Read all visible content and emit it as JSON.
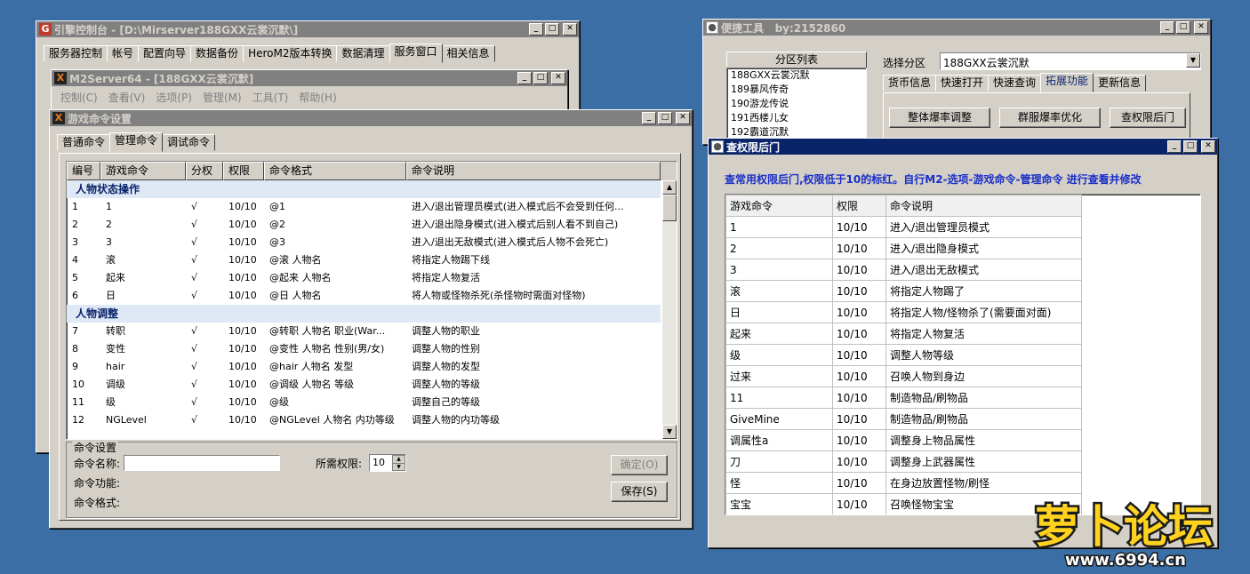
{
  "console": {
    "title": "引擎控制台 - [D:\\Mirserver188GXX云裳沉默\\]",
    "tabs": [
      "服务器控制",
      "帐号",
      "配置向导",
      "数据备份",
      "HeroM2版本转换",
      "数据清理",
      "服务窗口",
      "相关信息"
    ],
    "selected_tab": "服务窗口"
  },
  "m2server": {
    "title": "M2Server64 - [188GXX云裳沉默]",
    "menu": [
      "控制(C)",
      "查看(V)",
      "选项(P)",
      "管理(M)",
      "工具(T)",
      "帮助(H)"
    ]
  },
  "gamecmd": {
    "title": "游戏命令设置",
    "tabs": [
      "普通命令",
      "管理命令",
      "调试命令"
    ],
    "selected_tab": "管理命令",
    "columns": [
      "编号",
      "游戏命令",
      "分权",
      "权限",
      "命令格式",
      "命令说明"
    ],
    "groups": [
      {
        "name": "人物状态操作",
        "rows": [
          {
            "id": "1",
            "cmd": "1",
            "check": "√",
            "perm": "10/10",
            "fmt": "@1",
            "desc": "进入/退出管理员模式(进入模式后不会受到任何..."
          },
          {
            "id": "2",
            "cmd": "2",
            "check": "√",
            "perm": "10/10",
            "fmt": "@2",
            "desc": "进入/退出隐身模式(进入模式后别人看不到自己)"
          },
          {
            "id": "3",
            "cmd": "3",
            "check": "√",
            "perm": "10/10",
            "fmt": "@3",
            "desc": "进入/退出无敌模式(进入模式后人物不会死亡)"
          },
          {
            "id": "4",
            "cmd": "滚",
            "check": "√",
            "perm": "10/10",
            "fmt": "@滚 人物名",
            "desc": "将指定人物踢下线"
          },
          {
            "id": "5",
            "cmd": "起来",
            "check": "√",
            "perm": "10/10",
            "fmt": "@起来 人物名",
            "desc": "将指定人物复活"
          },
          {
            "id": "6",
            "cmd": "日",
            "check": "√",
            "perm": "10/10",
            "fmt": "@日 人物名",
            "desc": "将人物或怪物杀死(杀怪物时需面对怪物)"
          }
        ]
      },
      {
        "name": "人物调整",
        "rows": [
          {
            "id": "7",
            "cmd": "转职",
            "check": "√",
            "perm": "10/10",
            "fmt": "@转职 人物名 职业(War...",
            "desc": "调整人物的职业"
          },
          {
            "id": "8",
            "cmd": "变性",
            "check": "√",
            "perm": "10/10",
            "fmt": "@变性 人物名 性别(男/女)",
            "desc": "调整人物的性别"
          },
          {
            "id": "9",
            "cmd": "hair",
            "check": "√",
            "perm": "10/10",
            "fmt": "@hair 人物名 发型",
            "desc": "调整人物的发型"
          },
          {
            "id": "10",
            "cmd": "调级",
            "check": "√",
            "perm": "10/10",
            "fmt": "@调级 人物名 等级",
            "desc": "调整人物的等级"
          },
          {
            "id": "11",
            "cmd": "级",
            "check": "√",
            "perm": "10/10",
            "fmt": "@级",
            "desc": "调整自己的等级"
          },
          {
            "id": "12",
            "cmd": "NGLevel",
            "check": "√",
            "perm": "10/10",
            "fmt": "@NGLevel 人物名 内功等级",
            "desc": "调整人物的内功等级"
          }
        ]
      }
    ],
    "settings": {
      "group_title": "命令设置",
      "name_label": "命令名称:",
      "name_value": "",
      "perm_label": "所需权限:",
      "perm_value": "10",
      "func_label": "命令功能:",
      "fmt_label": "命令格式:",
      "ok_button": "确定(O)",
      "save_button": "保存(S)"
    }
  },
  "tools": {
    "title": "便捷工具",
    "by": "by:2152860",
    "zone_list_title": "分区列表",
    "zones": [
      "188GXX云裳沉默",
      "189暴风传奇",
      "190游龙传说",
      "191西楼儿女",
      "192霸道沉默"
    ],
    "select_label": "选择分区",
    "selected_zone": "188GXX云裳沉默",
    "tabs": [
      "货币信息",
      "快速打开",
      "快速查询",
      "拓展功能",
      "更新信息"
    ],
    "selected_tab": "拓展功能",
    "buttons": [
      "整体爆率调整",
      "群服爆率优化",
      "查权限后门"
    ]
  },
  "backdoor": {
    "title": "查权限后门",
    "notice": "查常用权限后门,权限低于10的标红。自行M2-选项-游戏命令-管理命令 进行查看并修改",
    "columns": [
      "游戏命令",
      "权限",
      "命令说明"
    ],
    "rows": [
      {
        "cmd": "1",
        "perm": "10/10",
        "desc": "进入/退出管理员模式"
      },
      {
        "cmd": "2",
        "perm": "10/10",
        "desc": "进入/退出隐身模式"
      },
      {
        "cmd": "3",
        "perm": "10/10",
        "desc": "进入/退出无敌模式"
      },
      {
        "cmd": "滚",
        "perm": "10/10",
        "desc": "将指定人物踢了"
      },
      {
        "cmd": "日",
        "perm": "10/10",
        "desc": "将指定人物/怪物杀了(需要面对面)"
      },
      {
        "cmd": "起来",
        "perm": "10/10",
        "desc": "将指定人物复活"
      },
      {
        "cmd": "级",
        "perm": "10/10",
        "desc": "调整人物等级"
      },
      {
        "cmd": "过来",
        "perm": "10/10",
        "desc": "召唤人物到身边"
      },
      {
        "cmd": "11",
        "perm": "10/10",
        "desc": "制造物品/刷物品"
      },
      {
        "cmd": "GiveMine",
        "perm": "10/10",
        "desc": "制造物品/刷物品"
      },
      {
        "cmd": "调属性a",
        "perm": "10/10",
        "desc": "调整身上物品属性"
      },
      {
        "cmd": "刀",
        "perm": "10/10",
        "desc": "调整身上武器属性"
      },
      {
        "cmd": "怪",
        "perm": "10/10",
        "desc": "在身边放置怪物/刷怪"
      },
      {
        "cmd": "宝宝",
        "perm": "10/10",
        "desc": "召唤怪物宝宝"
      }
    ]
  },
  "watermark": {
    "logo_text": "萝卜论坛",
    "url": "www.6994.cn"
  }
}
